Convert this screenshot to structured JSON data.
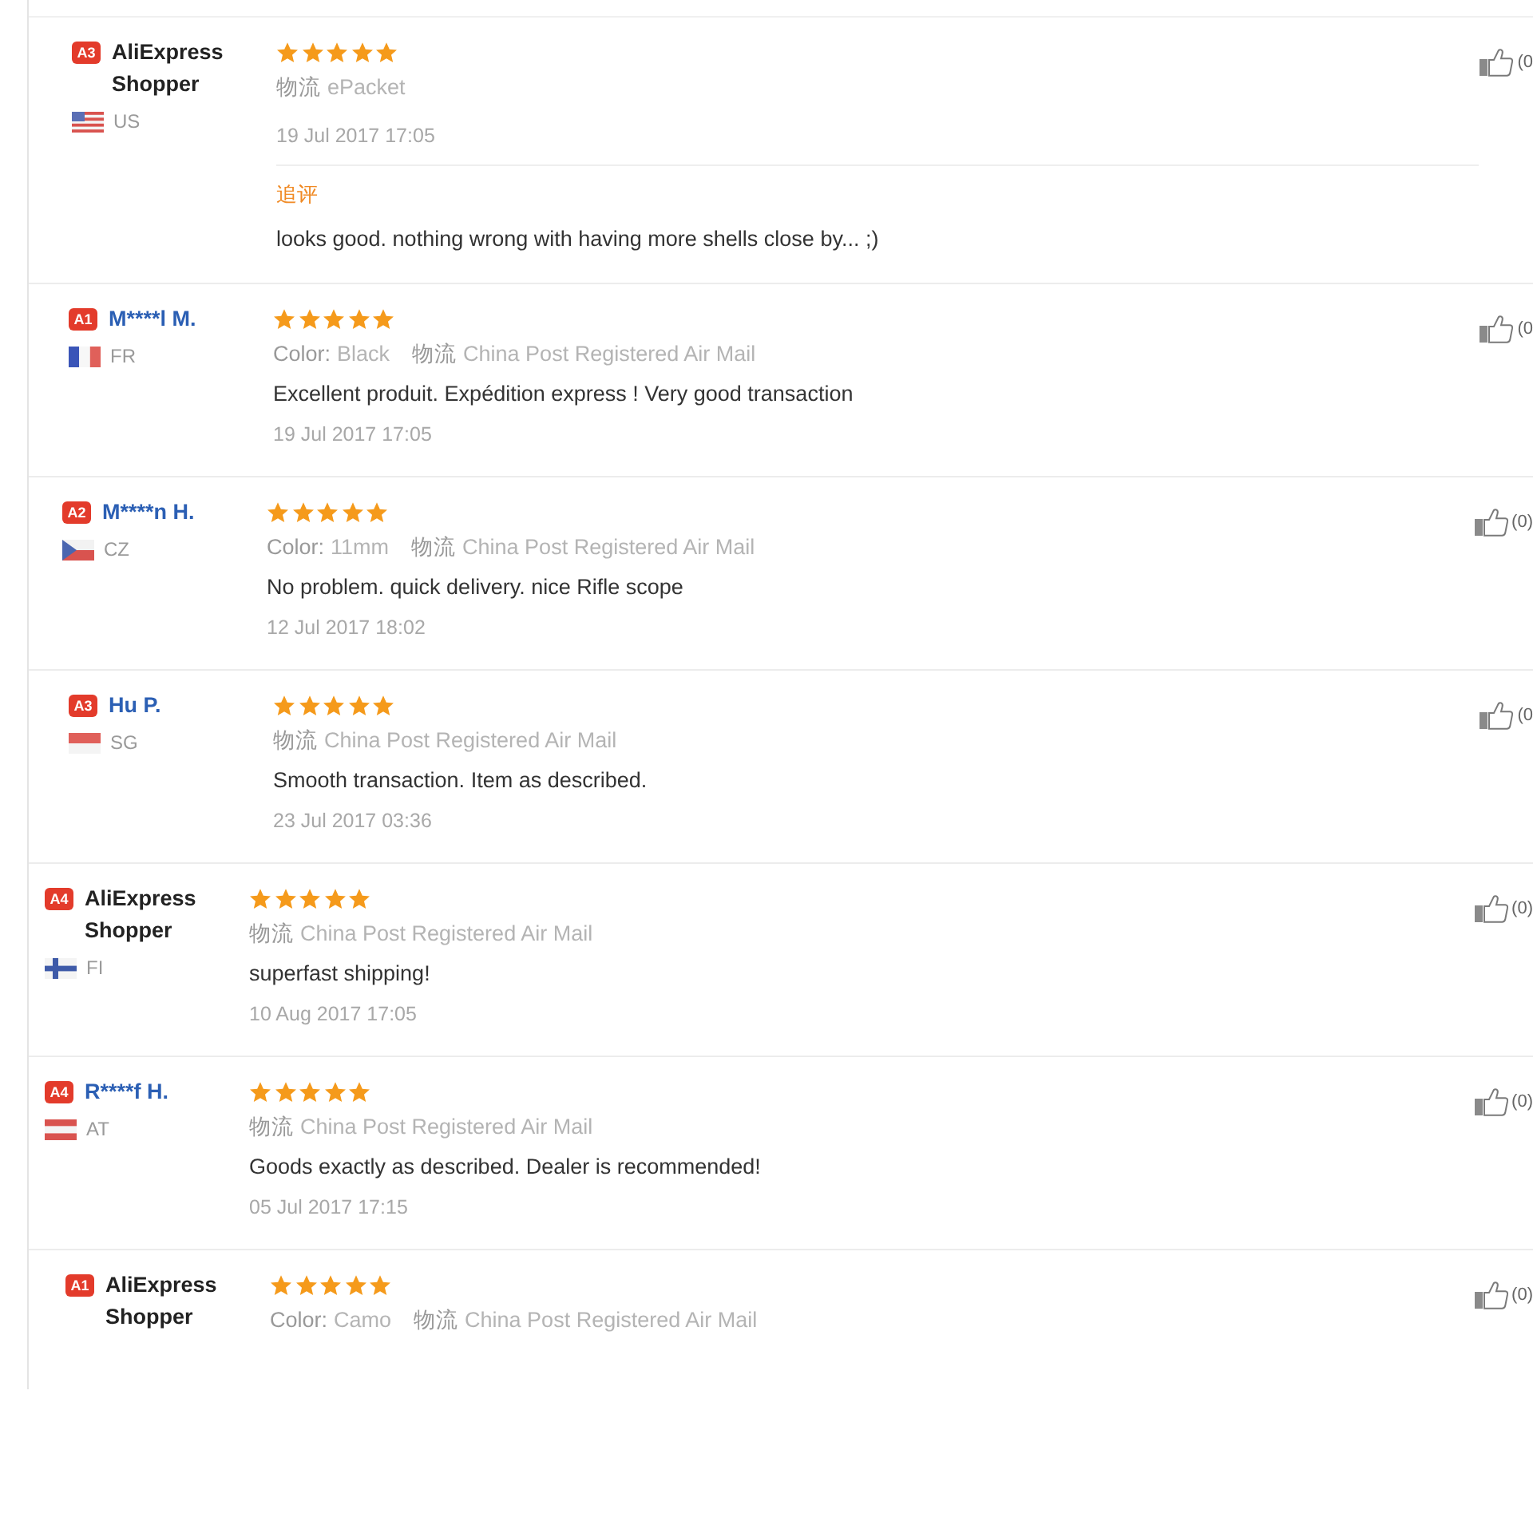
{
  "reviews": [
    {
      "badge": "A3",
      "name": "AliExpress Shopper",
      "kind": "anonymous",
      "country": {
        "kind": "us",
        "code": "US"
      },
      "stars": 5,
      "shipping": {
        "label": "物流",
        "value": "ePacket"
      },
      "date": "19 Jul 2017 17:05",
      "followup": {
        "label": "追评",
        "text": "looks good. nothing wrong with having more shells close by... ;)"
      },
      "helpful": "(0"
    },
    {
      "badge": "A1",
      "name": "M****l M.",
      "kind": "member",
      "country": {
        "kind": "fr",
        "code": "FR"
      },
      "stars": 5,
      "attributes": [
        {
          "label": "Color:",
          "value": "Black"
        }
      ],
      "shipping": {
        "label": "物流",
        "value": "China Post Registered Air Mail"
      },
      "text": "Excellent produit. Expédition express ! Very good transaction",
      "date": "19 Jul 2017 17:05",
      "helpful": "(0"
    },
    {
      "badge": "A2",
      "name": "M****n H.",
      "kind": "member",
      "country": {
        "kind": "cz",
        "code": "CZ"
      },
      "stars": 5,
      "attributes": [
        {
          "label": "Color:",
          "value": "11mm"
        }
      ],
      "shipping": {
        "label": "物流",
        "value": "China Post Registered Air Mail"
      },
      "text": "No problem. quick delivery. nice Rifle scope",
      "date": "12 Jul 2017 18:02",
      "helpful": "(0)"
    },
    {
      "badge": "A3",
      "name": "Hu P.",
      "kind": "member",
      "country": {
        "kind": "sg",
        "code": "SG"
      },
      "stars": 5,
      "shipping": {
        "label": "物流",
        "value": "China Post Registered Air Mail"
      },
      "text": "Smooth transaction. Item as described.",
      "date": "23 Jul 2017 03:36",
      "helpful": "(0"
    },
    {
      "badge": "A4",
      "name": "AliExpress Shopper",
      "kind": "anonymous",
      "country": {
        "kind": "fi",
        "code": "FI"
      },
      "stars": 5,
      "shipping": {
        "label": "物流",
        "value": "China Post Registered Air Mail"
      },
      "text": "superfast shipping!",
      "date": "10 Aug 2017 17:05",
      "helpful": "(0)"
    },
    {
      "badge": "A4",
      "name": "R****f H.",
      "kind": "member",
      "country": {
        "kind": "at",
        "code": "AT"
      },
      "stars": 5,
      "shipping": {
        "label": "物流",
        "value": "China Post Registered Air Mail"
      },
      "text": "Goods exactly as described. Dealer is recommended!",
      "date": "05 Jul 2017 17:15",
      "helpful": "(0)"
    },
    {
      "badge": "A1",
      "name": "AliExpress Shopper",
      "kind": "anonymous",
      "stars": 5,
      "attributes": [
        {
          "label": "Color:",
          "value": "Camo"
        }
      ],
      "shipping": {
        "label": "物流",
        "value": "China Post Registered Air Mail"
      },
      "helpful": "(0)"
    }
  ]
}
